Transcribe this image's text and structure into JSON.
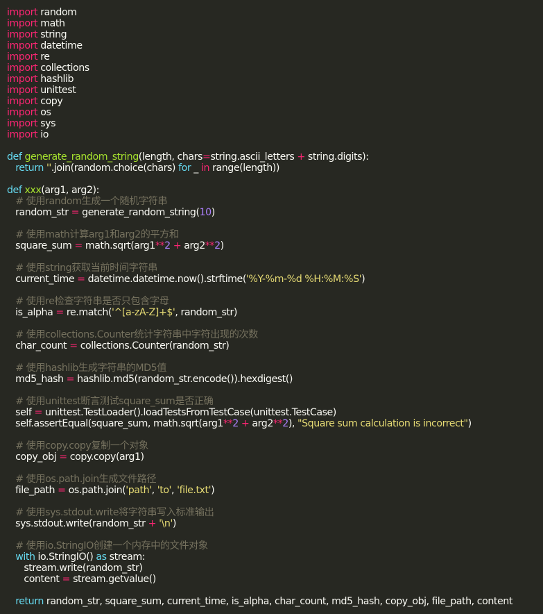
{
  "code_lines": [
    [
      {
        "t": "import",
        "c": "kw"
      },
      {
        "t": " random"
      }
    ],
    [
      {
        "t": "import",
        "c": "kw"
      },
      {
        "t": " math"
      }
    ],
    [
      {
        "t": "import",
        "c": "kw"
      },
      {
        "t": " string"
      }
    ],
    [
      {
        "t": "import",
        "c": "kw"
      },
      {
        "t": " datetime"
      }
    ],
    [
      {
        "t": "import",
        "c": "kw"
      },
      {
        "t": " re"
      }
    ],
    [
      {
        "t": "import",
        "c": "kw"
      },
      {
        "t": " collections"
      }
    ],
    [
      {
        "t": "import",
        "c": "kw"
      },
      {
        "t": " hashlib"
      }
    ],
    [
      {
        "t": "import",
        "c": "kw"
      },
      {
        "t": " unittest"
      }
    ],
    [
      {
        "t": "import",
        "c": "kw"
      },
      {
        "t": " copy"
      }
    ],
    [
      {
        "t": "import",
        "c": "kw"
      },
      {
        "t": " os"
      }
    ],
    [
      {
        "t": "import",
        "c": "kw"
      },
      {
        "t": " sys"
      }
    ],
    [
      {
        "t": "import",
        "c": "kw"
      },
      {
        "t": " io"
      }
    ],
    [],
    [
      {
        "t": "def",
        "c": "kw2"
      },
      {
        "t": " "
      },
      {
        "t": "generate_random_string",
        "c": "fn"
      },
      {
        "t": "(length, chars"
      },
      {
        "t": "=",
        "c": "op"
      },
      {
        "t": "string.ascii_letters "
      },
      {
        "t": "+",
        "c": "op"
      },
      {
        "t": " string.digits):"
      }
    ],
    [
      {
        "t": "   "
      },
      {
        "t": "return",
        "c": "kw2"
      },
      {
        "t": " "
      },
      {
        "t": "''",
        "c": "str"
      },
      {
        "t": ".join(random.choice(chars) "
      },
      {
        "t": "for",
        "c": "kw2"
      },
      {
        "t": " _ "
      },
      {
        "t": "in",
        "c": "kw"
      },
      {
        "t": " range(length))"
      }
    ],
    [],
    [
      {
        "t": "def",
        "c": "kw2"
      },
      {
        "t": " "
      },
      {
        "t": "xxx",
        "c": "fn"
      },
      {
        "t": "(arg1, arg2):"
      }
    ],
    [
      {
        "t": "   "
      },
      {
        "t": "# 使用random生成一个随机字符串",
        "c": "cm"
      }
    ],
    [
      {
        "t": "   random_str "
      },
      {
        "t": "=",
        "c": "op"
      },
      {
        "t": " generate_random_string("
      },
      {
        "t": "10",
        "c": "num"
      },
      {
        "t": ")"
      }
    ],
    [],
    [
      {
        "t": "   "
      },
      {
        "t": "# 使用math计算arg1和arg2的平方和",
        "c": "cm"
      }
    ],
    [
      {
        "t": "   square_sum "
      },
      {
        "t": "=",
        "c": "op"
      },
      {
        "t": " math.sqrt(arg1"
      },
      {
        "t": "**",
        "c": "op"
      },
      {
        "t": "2",
        "c": "num"
      },
      {
        "t": " "
      },
      {
        "t": "+",
        "c": "op"
      },
      {
        "t": " arg2"
      },
      {
        "t": "**",
        "c": "op"
      },
      {
        "t": "2",
        "c": "num"
      },
      {
        "t": ")"
      }
    ],
    [],
    [
      {
        "t": "   "
      },
      {
        "t": "# 使用string获取当前时间字符串",
        "c": "cm"
      }
    ],
    [
      {
        "t": "   current_time "
      },
      {
        "t": "=",
        "c": "op"
      },
      {
        "t": " datetime.datetime.now().strftime("
      },
      {
        "t": "'%Y-%m-%d %H:%M:%S'",
        "c": "str"
      },
      {
        "t": ")"
      }
    ],
    [],
    [
      {
        "t": "   "
      },
      {
        "t": "# 使用re检查字符串是否只包含字母",
        "c": "cm"
      }
    ],
    [
      {
        "t": "   is_alpha "
      },
      {
        "t": "=",
        "c": "op"
      },
      {
        "t": " re.match("
      },
      {
        "t": "'^[a-zA-Z]+$'",
        "c": "str"
      },
      {
        "t": ", random_str)"
      }
    ],
    [],
    [
      {
        "t": "   "
      },
      {
        "t": "# 使用collections.Counter统计字符串中字符出现的次数",
        "c": "cm"
      }
    ],
    [
      {
        "t": "   char_count "
      },
      {
        "t": "=",
        "c": "op"
      },
      {
        "t": " collections.Counter(random_str)"
      }
    ],
    [],
    [
      {
        "t": "   "
      },
      {
        "t": "# 使用hashlib生成字符串的MD5值",
        "c": "cm"
      }
    ],
    [
      {
        "t": "   md5_hash "
      },
      {
        "t": "=",
        "c": "op"
      },
      {
        "t": " hashlib.md5(random_str.encode()).hexdigest()"
      }
    ],
    [],
    [
      {
        "t": "   "
      },
      {
        "t": "# 使用unittest断言测试square_sum是否正确",
        "c": "cm"
      }
    ],
    [
      {
        "t": "   self "
      },
      {
        "t": "=",
        "c": "op"
      },
      {
        "t": " unittest.TestLoader().loadTestsFromTestCase(unittest.TestCase)"
      }
    ],
    [
      {
        "t": "   self.assertEqual(square_sum, math.sqrt(arg1"
      },
      {
        "t": "**",
        "c": "op"
      },
      {
        "t": "2",
        "c": "num"
      },
      {
        "t": " "
      },
      {
        "t": "+",
        "c": "op"
      },
      {
        "t": " arg2"
      },
      {
        "t": "**",
        "c": "op"
      },
      {
        "t": "2",
        "c": "num"
      },
      {
        "t": "), "
      },
      {
        "t": "\"Square sum calculation is incorrect\"",
        "c": "str"
      },
      {
        "t": ")"
      }
    ],
    [],
    [
      {
        "t": "   "
      },
      {
        "t": "# 使用copy.copy复制一个对象",
        "c": "cm"
      }
    ],
    [
      {
        "t": "   copy_obj "
      },
      {
        "t": "=",
        "c": "op"
      },
      {
        "t": " copy.copy(arg1)"
      }
    ],
    [],
    [
      {
        "t": "   "
      },
      {
        "t": "# 使用os.path.join生成文件路径",
        "c": "cm"
      }
    ],
    [
      {
        "t": "   file_path "
      },
      {
        "t": "=",
        "c": "op"
      },
      {
        "t": " os.path.join("
      },
      {
        "t": "'path'",
        "c": "str"
      },
      {
        "t": ", "
      },
      {
        "t": "'to'",
        "c": "str"
      },
      {
        "t": ", "
      },
      {
        "t": "'file.txt'",
        "c": "str"
      },
      {
        "t": ")"
      }
    ],
    [],
    [
      {
        "t": "   "
      },
      {
        "t": "# 使用sys.stdout.write将字符串写入标准输出",
        "c": "cm"
      }
    ],
    [
      {
        "t": "   sys.stdout.write(random_str "
      },
      {
        "t": "+",
        "c": "op"
      },
      {
        "t": " "
      },
      {
        "t": "'\\n'",
        "c": "str"
      },
      {
        "t": ")"
      }
    ],
    [],
    [
      {
        "t": "   "
      },
      {
        "t": "# 使用io.StringIO创建一个内存中的文件对象",
        "c": "cm"
      }
    ],
    [
      {
        "t": "   "
      },
      {
        "t": "with",
        "c": "kw2"
      },
      {
        "t": " io.StringIO() "
      },
      {
        "t": "as",
        "c": "kw2"
      },
      {
        "t": " stream:"
      }
    ],
    [
      {
        "t": "      stream.write(random_str)"
      }
    ],
    [
      {
        "t": "      content "
      },
      {
        "t": "=",
        "c": "op"
      },
      {
        "t": " stream.getvalue()"
      }
    ],
    [],
    [
      {
        "t": "   "
      },
      {
        "t": "return",
        "c": "kw2"
      },
      {
        "t": " random_str, square_sum, current_time, is_alpha, char_count, md5_hash, copy_obj, file_path, content"
      }
    ]
  ]
}
